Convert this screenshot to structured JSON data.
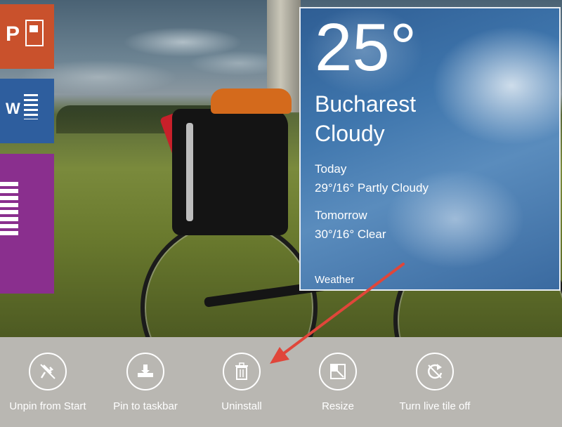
{
  "start_tiles": {
    "powerpoint": {
      "glyph": "P"
    },
    "word": {
      "glyph": "W"
    }
  },
  "weather_tile": {
    "temperature": "25°",
    "city": "Bucharest",
    "condition": "Cloudy",
    "today_label": "Today",
    "today_forecast": "29°/16° Partly Cloudy",
    "tomorrow_label": "Tomorrow",
    "tomorrow_forecast": "30°/16° Clear",
    "app_name": "Weather"
  },
  "app_bar": {
    "commands": [
      {
        "label": "Unpin from Start",
        "icon": "unpin-icon"
      },
      {
        "label": "Pin to taskbar",
        "icon": "pin-taskbar-icon"
      },
      {
        "label": "Uninstall",
        "icon": "trash-icon"
      },
      {
        "label": "Resize",
        "icon": "resize-icon"
      },
      {
        "label": "Turn live tile off",
        "icon": "live-tile-off-icon"
      }
    ]
  },
  "colors": {
    "app_bar_bg": "#b9b7b2",
    "powerpoint_tile": "#c9512c",
    "word_tile": "#2e5e9e",
    "onenote_tile": "#8a2f8e",
    "annotation_arrow": "#e0463a"
  }
}
